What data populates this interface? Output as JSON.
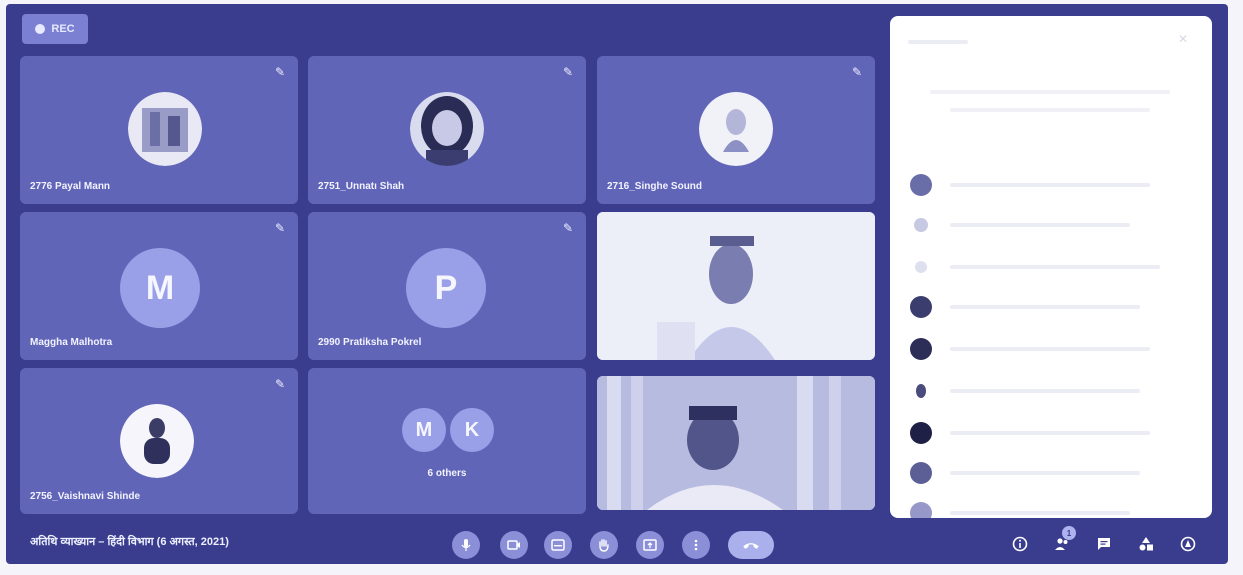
{
  "recording": {
    "label": "REC"
  },
  "tiles": [
    {
      "name": "2776 Payal Mann",
      "type": "photo-avatar"
    },
    {
      "name": "2751_Unnatı Shah",
      "type": "photo-avatar"
    },
    {
      "name": "2716_Singhe Sound",
      "type": "photo-avatar"
    },
    {
      "name": "Maggha Malhotra",
      "type": "letter",
      "letter": "M"
    },
    {
      "name": "2990 Pratiksha Pokrel",
      "type": "letter",
      "letter": "P"
    },
    {
      "name": "",
      "type": "video"
    },
    {
      "name": "2756_Vaishnavi Shinde",
      "type": "photo-avatar"
    },
    {
      "name": "6 others",
      "type": "others",
      "letters": [
        "M",
        "K"
      ]
    },
    {
      "name": "",
      "type": "video"
    }
  ],
  "meeting": {
    "title": "अतिथि व्याख्यान – हिंदी विभाग (6 अगस्त, 2021)"
  },
  "controls": [
    "mic-icon",
    "camera-icon",
    "captions-icon",
    "raise-hand-icon",
    "present-icon",
    "more-options-icon",
    "end-call-icon"
  ],
  "right_controls": [
    "info-icon",
    "people-icon",
    "chat-icon",
    "activities-icon",
    "host-controls-icon"
  ],
  "people_count": "1",
  "colors": {
    "background": "#3a3d8e",
    "tile": "#6165b8",
    "panel": "#ffffff",
    "accent": "#8a8fd8"
  }
}
